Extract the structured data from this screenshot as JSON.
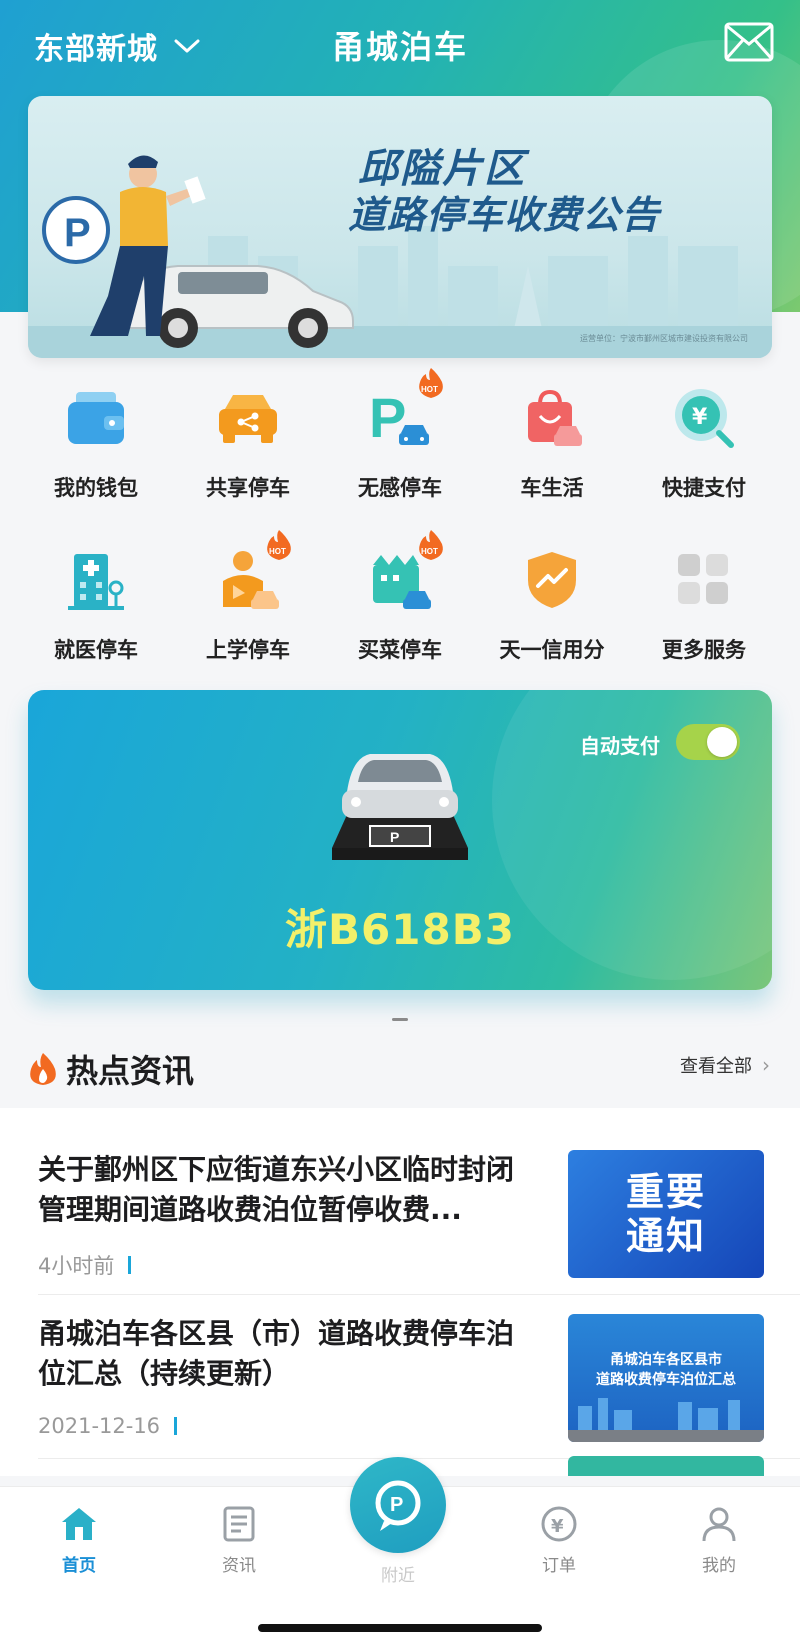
{
  "header": {
    "city": "东部新城",
    "title": "甬城泊车"
  },
  "banner": {
    "line1": "邱隘片区",
    "line2": "道路停车收费公告",
    "footnote": "运营单位：宁波市鄞州区城市建设投资有限公司"
  },
  "services": [
    {
      "label": "我的钱包",
      "icon": "wallet-icon",
      "hot": false
    },
    {
      "label": "共享停车",
      "icon": "shared-parking-icon",
      "hot": false
    },
    {
      "label": "无感停车",
      "icon": "p-car-icon",
      "hot": true
    },
    {
      "label": "车生活",
      "icon": "car-life-bag-icon",
      "hot": false
    },
    {
      "label": "快捷支付",
      "icon": "yuan-search-icon",
      "hot": false
    },
    {
      "label": "就医停车",
      "icon": "hospital-icon",
      "hot": false
    },
    {
      "label": "上学停车",
      "icon": "school-icon",
      "hot": true
    },
    {
      "label": "买菜停车",
      "icon": "market-icon",
      "hot": true
    },
    {
      "label": "天一信用分",
      "icon": "credit-shield-icon",
      "hot": false
    },
    {
      "label": "更多服务",
      "icon": "grid-more-icon",
      "hot": false
    }
  ],
  "hot_badge": "HOT",
  "car_card": {
    "auto_pay_label": "自动支付",
    "auto_pay_on": true,
    "plate": "浙B618B3"
  },
  "news": {
    "heading": "热点资讯",
    "see_all": "查看全部",
    "items": [
      {
        "title": "关于鄞州区下应街道东兴小区临时封闭管理期间道路收费泊位暂停收费...",
        "time": "4小时前",
        "thumb_text": "重要\n通知"
      },
      {
        "title": "甬城泊车各区县（市）道路收费停车泊位汇总（持续更新）",
        "time": "2021-12-16",
        "thumb_text": "甬城泊车各区县市\n道路收费停车泊位汇总"
      }
    ]
  },
  "tabs": [
    {
      "label": "首页",
      "icon": "home-icon",
      "active": true
    },
    {
      "label": "资讯",
      "icon": "news-icon",
      "active": false
    },
    {
      "label": "附近",
      "icon": "nearby-parking-icon",
      "active": false
    },
    {
      "label": "订单",
      "icon": "order-icon",
      "active": false
    },
    {
      "label": "我的",
      "icon": "profile-icon",
      "active": false
    }
  ],
  "colors": {
    "accent": "#1a8fd6",
    "plate_text": "#f3f06a",
    "toggle_on": "#a6d34a"
  }
}
